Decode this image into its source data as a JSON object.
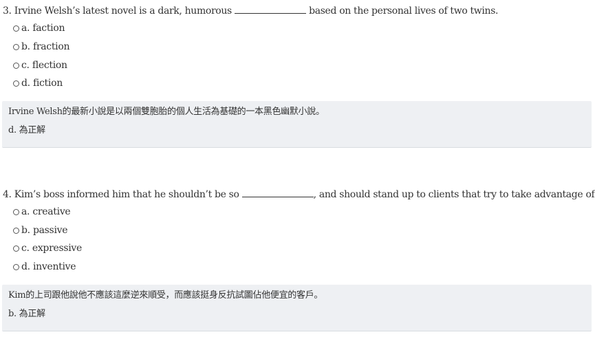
{
  "questions": [
    {
      "stem_before": "3. Irvine Welsh’s latest novel is a dark, humorous",
      "stem_after": "based on the personal lives of two twins.",
      "options": [
        "a. faction",
        "b. fraction",
        "c. flection",
        "d. fiction"
      ],
      "explanation": "Irvine Welsh的最新小說是以兩個雙胞胎的個人生活為基礎的一本黑色幽默小說。",
      "answer": "d. 為正解"
    },
    {
      "stem_before": "4. Kim’s boss informed him that he shouldn’t be so",
      "stem_after": ", and should stand up to clients that try to take advantage of him.",
      "options": [
        "a. creative",
        "b. passive",
        "c. expressive",
        "d. inventive"
      ],
      "explanation": "Kim的上司跟他說他不應該這麼逆來順受，而應該挺身反抗試圖佔他便宜的客戶。",
      "answer": "b. 為正解"
    }
  ]
}
